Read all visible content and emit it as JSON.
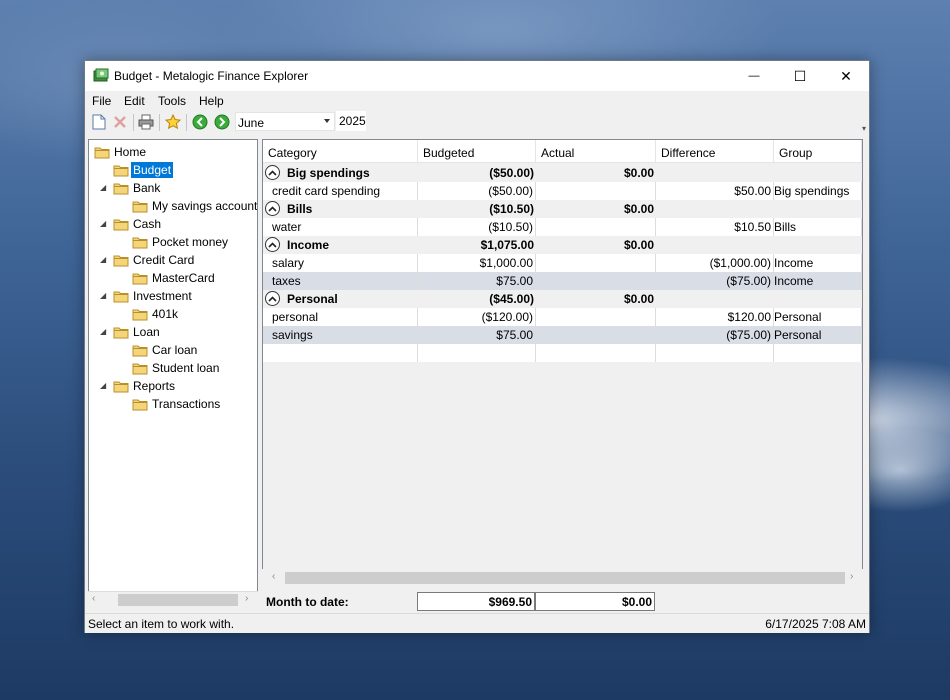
{
  "window": {
    "title": "Budget - Metalogic Finance Explorer",
    "controls": {
      "minimize": "—",
      "maximize": "☐",
      "close": "✕"
    }
  },
  "menu": [
    "File",
    "Edit",
    "Tools",
    "Help"
  ],
  "toolbar": {
    "month": "June",
    "year": "2025"
  },
  "tree": [
    {
      "label": "Home",
      "level": 0
    },
    {
      "label": "Budget",
      "level": 1,
      "selected": true
    },
    {
      "label": "Bank",
      "level": 1,
      "expandable": true
    },
    {
      "label": "My savings account",
      "level": 2
    },
    {
      "label": "Cash",
      "level": 1,
      "expandable": true
    },
    {
      "label": "Pocket money",
      "level": 2
    },
    {
      "label": "Credit Card",
      "level": 1,
      "expandable": true
    },
    {
      "label": "MasterCard",
      "level": 2
    },
    {
      "label": "Investment",
      "level": 1,
      "expandable": true
    },
    {
      "label": "401k",
      "level": 2
    },
    {
      "label": "Loan",
      "level": 1,
      "expandable": true
    },
    {
      "label": "Car loan",
      "level": 2
    },
    {
      "label": "Student loan",
      "level": 2
    },
    {
      "label": "Reports",
      "level": 1,
      "expandable": true
    },
    {
      "label": "Transactions",
      "level": 2
    }
  ],
  "grid": {
    "columns": [
      "Category",
      "Budgeted",
      "Actual",
      "Difference",
      "Group"
    ],
    "rows": [
      {
        "type": "group",
        "category": "Big spendings",
        "budgeted": "($50.00)",
        "actual": "$0.00",
        "difference": "",
        "group": ""
      },
      {
        "type": "item",
        "category": "credit card spending",
        "budgeted": "($50.00)",
        "actual": "",
        "difference": "$50.00",
        "group": "Big spendings"
      },
      {
        "type": "group",
        "category": "Bills",
        "budgeted": "($10.50)",
        "actual": "$0.00",
        "difference": "",
        "group": ""
      },
      {
        "type": "item",
        "category": "water",
        "budgeted": "($10.50)",
        "actual": "",
        "difference": "$10.50",
        "group": "Bills"
      },
      {
        "type": "group",
        "category": "Income",
        "budgeted": "$1,075.00",
        "actual": "$0.00",
        "difference": "",
        "group": ""
      },
      {
        "type": "item",
        "category": "salary",
        "budgeted": "$1,000.00",
        "actual": "",
        "difference": "($1,000.00)",
        "group": "Income"
      },
      {
        "type": "item-alt",
        "category": "taxes",
        "budgeted": "$75.00",
        "actual": "",
        "difference": "($75.00)",
        "group": "Income"
      },
      {
        "type": "group",
        "category": "Personal",
        "budgeted": "($45.00)",
        "actual": "$0.00",
        "difference": "",
        "group": ""
      },
      {
        "type": "item",
        "category": "personal",
        "budgeted": "($120.00)",
        "actual": "",
        "difference": "$120.00",
        "group": "Personal"
      },
      {
        "type": "item-alt",
        "category": "savings",
        "budgeted": "$75.00",
        "actual": "",
        "difference": "($75.00)",
        "group": "Personal"
      },
      {
        "type": "new",
        "category": "",
        "budgeted": "",
        "actual": "",
        "difference": "",
        "group": ""
      }
    ]
  },
  "footer": {
    "label": "Month to date:",
    "budgeted": "$969.50",
    "actual": "$0.00"
  },
  "status": {
    "message": "Select an item to work with.",
    "datetime": "6/17/2025  7:08 AM"
  }
}
